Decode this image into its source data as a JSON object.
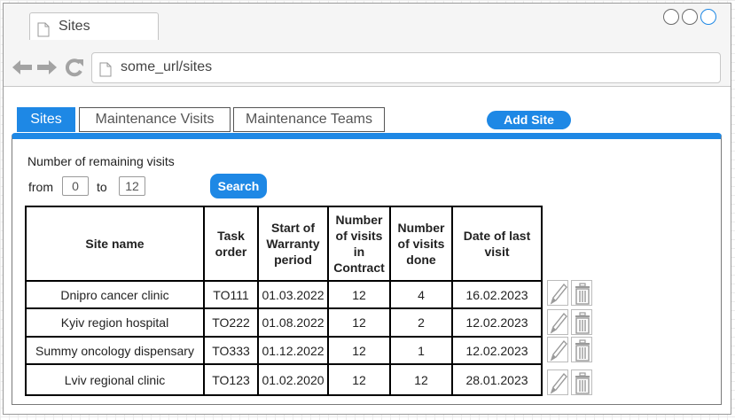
{
  "browser": {
    "tab_title": "Sites",
    "url": "some_url/sites"
  },
  "tabs": [
    "Sites",
    "Maintenance Visits",
    "Maintenance Teams"
  ],
  "add_site_label": "Add Site",
  "filter": {
    "label": "Number of remaining visits",
    "from_label": "from",
    "from_value": "0",
    "to_label": "to",
    "to_value": "12",
    "search_label": "Search"
  },
  "table": {
    "headers": {
      "site_name": "Site name",
      "task_order_l1": "Task",
      "task_order_l2": "order",
      "warranty_l1": "Start of",
      "warranty_l2": "Warranty",
      "warranty_l3": "period",
      "contract_l1": "Number",
      "contract_l2": "of visits",
      "contract_l3": "in",
      "contract_l4": "Contract",
      "done_l1": "Number",
      "done_l2": "of visits",
      "done_l3": "done",
      "last_l1": "Date of last",
      "last_l2": "visit"
    },
    "rows": [
      {
        "site": "Dnipro cancer clinic",
        "task": "TO111",
        "warranty": "01.03.2022",
        "contract": "12",
        "done": "4",
        "last": "16.02.2023"
      },
      {
        "site": "Kyiv region hospital",
        "task": "TO222",
        "warranty": "01.08.2022",
        "contract": "12",
        "done": "2",
        "last": "12.02.2023"
      },
      {
        "site": "Summy oncology dispensary",
        "task": "TO333",
        "warranty": "01.12.2022",
        "contract": "12",
        "done": "1",
        "last": "12.02.2023"
      },
      {
        "site": "Lviv regional clinic",
        "task": "TO123",
        "warranty": "01.02.2020",
        "contract": "12",
        "done": "12",
        "last": "28.01.2023"
      }
    ]
  },
  "icons": {
    "back": "arrow-left-icon",
    "forward": "arrow-right-icon",
    "reload": "reload-icon",
    "page": "document-icon",
    "edit": "pencil-icon",
    "delete": "trash-icon"
  },
  "colors": {
    "accent": "#1e88e5"
  }
}
